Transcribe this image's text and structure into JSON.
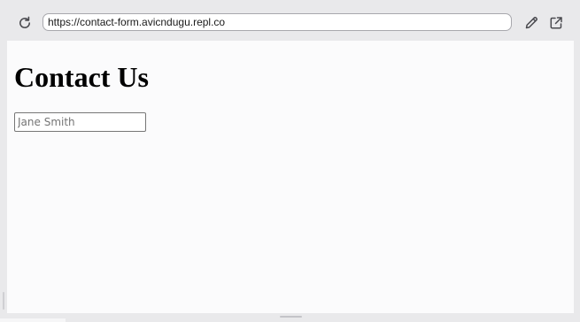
{
  "browser": {
    "url": "https://contact-form.avicndugu.repl.co",
    "icons": {
      "reload": "reload-icon",
      "edit": "pencil-icon",
      "external": "open-external-icon"
    }
  },
  "page": {
    "title": "Contact Us",
    "name_input": {
      "placeholder": "Jane Smith",
      "value": ""
    }
  }
}
